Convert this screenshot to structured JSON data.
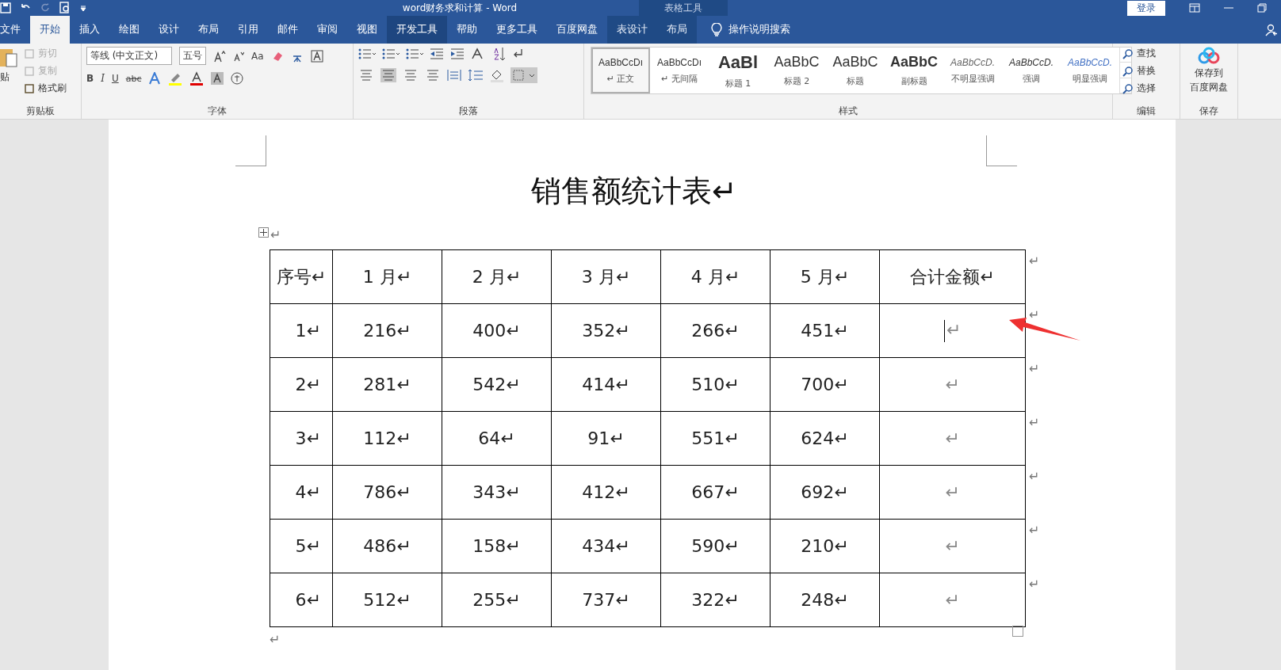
{
  "title_bar": {
    "title": "word财务求和计算  -  Word",
    "context_label": "表格工具",
    "login": "登录"
  },
  "tabs": [
    {
      "label": "文件",
      "selected": false,
      "hovered": false,
      "contextual": false
    },
    {
      "label": "开始",
      "selected": true,
      "hovered": false,
      "contextual": false
    },
    {
      "label": "插入",
      "selected": false,
      "hovered": false,
      "contextual": false
    },
    {
      "label": "绘图",
      "selected": false,
      "hovered": false,
      "contextual": false
    },
    {
      "label": "设计",
      "selected": false,
      "hovered": false,
      "contextual": false
    },
    {
      "label": "布局",
      "selected": false,
      "hovered": false,
      "contextual": false
    },
    {
      "label": "引用",
      "selected": false,
      "hovered": false,
      "contextual": false
    },
    {
      "label": "邮件",
      "selected": false,
      "hovered": false,
      "contextual": false
    },
    {
      "label": "审阅",
      "selected": false,
      "hovered": false,
      "contextual": false
    },
    {
      "label": "视图",
      "selected": false,
      "hovered": false,
      "contextual": false
    },
    {
      "label": "开发工具",
      "selected": false,
      "hovered": true,
      "contextual": false
    },
    {
      "label": "帮助",
      "selected": false,
      "hovered": false,
      "contextual": false
    },
    {
      "label": "更多工具",
      "selected": false,
      "hovered": false,
      "contextual": false
    },
    {
      "label": "百度网盘",
      "selected": false,
      "hovered": false,
      "contextual": false
    },
    {
      "label": "表设计",
      "selected": false,
      "hovered": false,
      "contextual": true
    },
    {
      "label": "布局",
      "selected": false,
      "hovered": false,
      "contextual": true
    }
  ],
  "tell_me": "操作说明搜索",
  "ribbon": {
    "clipboard": {
      "label": "剪贴板",
      "paste": "贴",
      "items": [
        {
          "label": "剪切",
          "disabled": true
        },
        {
          "label": "复制",
          "disabled": true
        },
        {
          "label": "格式刷",
          "disabled": false
        }
      ]
    },
    "font": {
      "label": "字体",
      "font_name": "等线 (中文正文)",
      "font_size": "五号",
      "case_button": "Aa",
      "format_buttons": [
        "B",
        "I",
        "U",
        "abc"
      ]
    },
    "paragraph": {
      "label": "段落"
    },
    "styles": {
      "label": "样式",
      "items": [
        {
          "preview": "AaBbCcDı",
          "name": "↵ 正文",
          "kind": "normal",
          "selected": true
        },
        {
          "preview": "AaBbCcDı",
          "name": "↵ 无间隔",
          "kind": "normal",
          "selected": false
        },
        {
          "preview": "AaBl",
          "name": "标题 1",
          "kind": "heading1",
          "selected": false
        },
        {
          "preview": "AaBbC",
          "name": "标题 2",
          "kind": "heading2",
          "selected": false
        },
        {
          "preview": "AaBbC",
          "name": "标题",
          "kind": "title",
          "selected": false
        },
        {
          "preview": "AaBbC",
          "name": "副标题",
          "kind": "subtitle",
          "selected": false
        },
        {
          "preview": "AaBbCcD.",
          "name": "不明显强调",
          "kind": "subtle",
          "selected": false
        },
        {
          "preview": "AaBbCcD.",
          "name": "强调",
          "kind": "emphasis",
          "selected": false
        },
        {
          "preview": "AaBbCcD.",
          "name": "明显强调",
          "kind": "intense",
          "selected": false
        }
      ]
    },
    "editing": {
      "label": "编辑",
      "items": [
        "查找",
        "替换",
        "选择"
      ]
    },
    "save": {
      "label": "保存",
      "lines": [
        "保存到",
        "百度网盘"
      ]
    }
  },
  "document": {
    "heading": "销售额统计表↵",
    "before_table_mark": "↵",
    "after_table_mark": "↵",
    "table": {
      "header": {
        "cells": [
          "序号↵",
          "1 月↵",
          "2 月↵",
          "3 月↵",
          "4 月↵",
          "5 月↵",
          "合计金额↵"
        ],
        "end_mark": "↵"
      },
      "rows": [
        {
          "cells": [
            "1↵",
            "216↵",
            "400↵",
            "352↵",
            "266↵",
            "451↵",
            "↵"
          ],
          "end_mark": "↵",
          "cursor": true
        },
        {
          "cells": [
            "2↵",
            "281↵",
            "542↵",
            "414↵",
            "510↵",
            "700↵",
            "↵"
          ],
          "end_mark": "↵",
          "cursor": false
        },
        {
          "cells": [
            "3↵",
            "112↵",
            "64↵",
            "91↵",
            "551↵",
            "624↵",
            "↵"
          ],
          "end_mark": "↵",
          "cursor": false
        },
        {
          "cells": [
            "4↵",
            "786↵",
            "343↵",
            "412↵",
            "667↵",
            "692↵",
            "↵"
          ],
          "end_mark": "↵",
          "cursor": false
        },
        {
          "cells": [
            "5↵",
            "486↵",
            "158↵",
            "434↵",
            "590↵",
            "210↵",
            "↵"
          ],
          "end_mark": "↵",
          "cursor": false
        },
        {
          "cells": [
            "6↵",
            "512↵",
            "255↵",
            "737↵",
            "322↵",
            "248↵",
            "↵"
          ],
          "end_mark": "↵",
          "cursor": false
        }
      ]
    }
  }
}
